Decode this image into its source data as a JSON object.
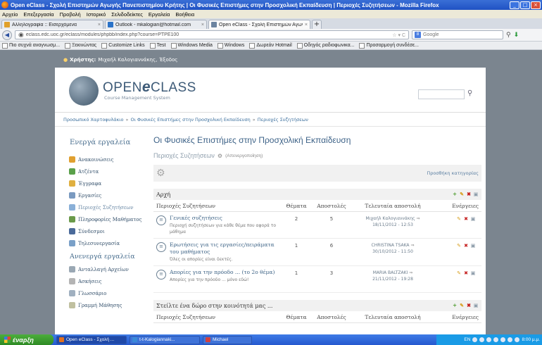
{
  "window": {
    "title": "Open eClass - Σχολή Επιστημών Αγωγής Πανεπιστημίου Κρήτης | Οι Φυσικές Επιστήμες στην Προσχολική Εκπαίδευση | Περιοχές Συζητήσεων - Mozilla Firefox"
  },
  "menu": [
    "Αρχείο",
    "Επεξεργασία",
    "Προβολή",
    "Ιστορικό",
    "Σελιδοδείκτες",
    "Εργαλεία",
    "Βοήθεια"
  ],
  "tabs": [
    {
      "label": "Αλληλογραφία :: Εισερχόμενα",
      "color": "#e0a02a",
      "active": false
    },
    {
      "label": "Outlook - mkalogian@hotmail.com",
      "color": "#2a72c8",
      "active": false
    },
    {
      "label": "Open eClass - Σχολή Επιστημών Αγωγής ...",
      "color": "#6c84a0",
      "active": true
    }
  ],
  "nav": {
    "url": "eclass.edc.uoc.gr/eclass/modules/phpbb/index.php?course=PTPE100",
    "search_placeholder": "Google"
  },
  "bookmarks": [
    "Πιο συχνά αναγνωσμ...",
    "Ξεκινώντας",
    "Customize Links",
    "Test",
    "Windows Media",
    "Windows",
    "Δωρεάν Hotmail",
    "Οδηγός ραδιοφωνικα...",
    "Προσαρμογή συνδέσε..."
  ],
  "user": {
    "label": "Χρήστης:",
    "name": "Μιχαήλ Καλογιαννάκης,",
    "logout": "Έξοδος"
  },
  "logo": {
    "open": "OPEN",
    "e": "e",
    "class": "CLASS",
    "sub": "Course Management System"
  },
  "breadcrumb": [
    "Προσωπικό Χαρτοφυλάκιο",
    "»",
    "Οι Φυσικές Επιστήμες στην Προσχολική Εκπαίδευση",
    "»",
    "Περιοχές Συζητήσεων"
  ],
  "sidebar": {
    "heading_active": "Ενεργά εργαλεία",
    "active_items": [
      {
        "label": "Ανακοινώσεις",
        "color": "#e0a030",
        "current": false
      },
      {
        "label": "Ατζέντα",
        "color": "#5aa04a",
        "current": false
      },
      {
        "label": "Έγγραφα",
        "color": "#e0b040",
        "current": false
      },
      {
        "label": "Εργασίες",
        "color": "#7a9ac0",
        "current": false
      },
      {
        "label": "Περιοχές Συζητήσεων",
        "color": "#8ab0d8",
        "current": true
      },
      {
        "label": "Πληροφορίες Μαθήματος",
        "color": "#6a9a4a",
        "current": false
      },
      {
        "label": "Σύνδεσμοι",
        "color": "#4a6a9a",
        "current": false
      },
      {
        "label": "Τηλεσυνεργασία",
        "color": "#7aa0c8",
        "current": false
      }
    ],
    "heading_inactive": "Ανενεργά εργαλεία",
    "inactive_items": [
      {
        "label": "Ανταλλαγή Αρχείων",
        "color": "#9aa8b4"
      },
      {
        "label": "Ασκήσεις",
        "color": "#b4b4b4"
      },
      {
        "label": "Γλωσσάριο",
        "color": "#a0b0c0"
      },
      {
        "label": "Γραμμή Μάθησης",
        "color": "#c0c0a0"
      }
    ]
  },
  "content": {
    "title": "Οι Φυσικές Επιστήμες στην Προσχολική Εκπαίδευση",
    "subtitle": "Περιοχές Συζητήσεων",
    "subtitle_badge": "(Απενεργοποίηση)",
    "add_category": "Προσθήκη κατηγορίας",
    "columns": [
      "Περιοχές Συζητήσεων",
      "Θέματα",
      "Αποστολές",
      "Τελευταία αποστολή",
      "Ενέργειες"
    ],
    "categories": [
      {
        "name": "Αρχή",
        "forums": [
          {
            "title": "Γενικές συζητήσεις",
            "desc": "Περιοχή συζητήσεων για κάθε θέμα που αφορά το μάθημα",
            "topics": "2",
            "posts": "5",
            "last_user": "Μιχαήλ Καλογιαννάκης",
            "last_date": "18/11/2012 - 12:53"
          },
          {
            "title": "Ερωτήσεις για τις εργασίες/πειράματα του μαθήματος",
            "desc": "Όλες οι απορίες είναι δεκτές.",
            "topics": "1",
            "posts": "6",
            "last_user": "CHRISTINA TSAKA",
            "last_date": "30/10/2012 - 11:50"
          },
          {
            "title": "Απορίες για την πρόοδο ... (το 2ο θέμα)",
            "desc": "Απορίες για την πρόοδο ... μόνο εδώ!",
            "topics": "1",
            "posts": "3",
            "last_user": "MARIA BALTZAKI",
            "last_date": "21/11/2012 - 19:28"
          }
        ]
      },
      {
        "name": "Στείλτε ένα δώρο στην κοινότητά μας ...",
        "forums": []
      }
    ]
  },
  "taskbar": {
    "start": "έναρξη",
    "items": [
      {
        "label": "Open eClass - Σχολή ...",
        "color": "#e07020",
        "active": true
      },
      {
        "label": "t-t-Kalogiannaki...",
        "color": "#3a8ad8",
        "active": false
      },
      {
        "label": "Michael",
        "color": "#d04040",
        "active": false
      }
    ],
    "lang": "EN",
    "clock": "8:00 μ.μ."
  }
}
